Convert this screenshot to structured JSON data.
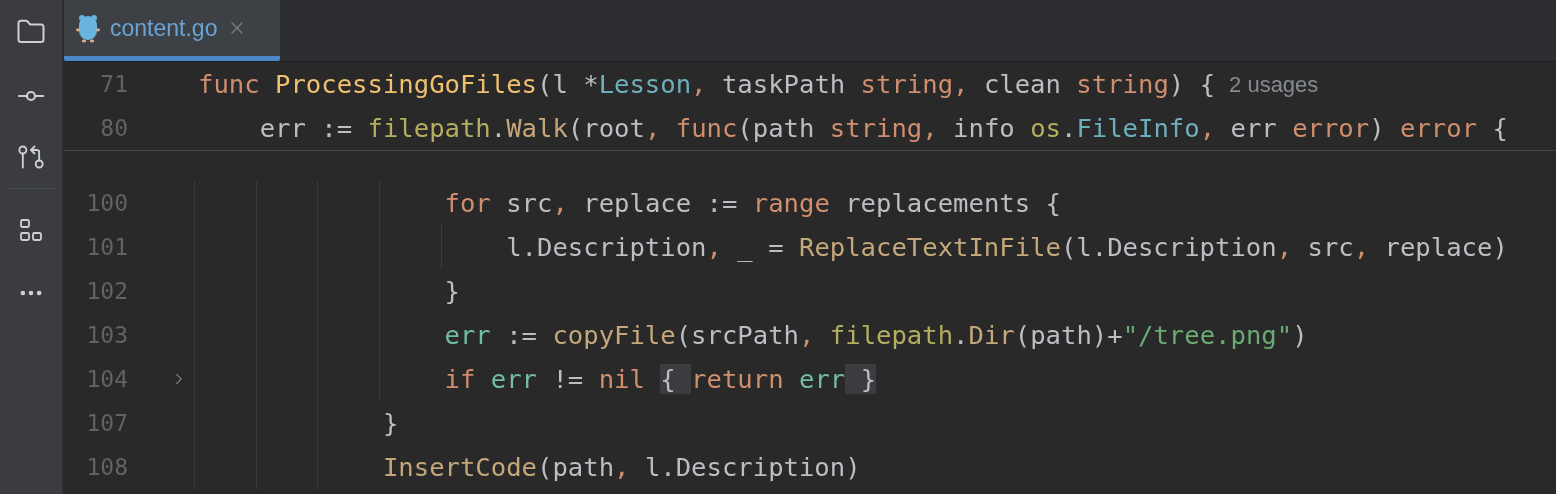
{
  "tabs": [
    {
      "label": "content.go",
      "selected": true
    }
  ],
  "sticky_lines": [
    {
      "number": "71",
      "hint": "2 usages",
      "tokens": [
        {
          "text": "func ",
          "kind": "keyword"
        },
        {
          "text": "ProcessingGoFiles",
          "kind": "decl"
        },
        {
          "text": "(l *",
          "kind": "plain"
        },
        {
          "text": "Lesson",
          "kind": "type"
        },
        {
          "text": ",",
          "kind": "keyword"
        },
        {
          "text": " taskPath ",
          "kind": "plain"
        },
        {
          "text": "string",
          "kind": "keyword"
        },
        {
          "text": ",",
          "kind": "keyword"
        },
        {
          "text": " clean ",
          "kind": "plain"
        },
        {
          "text": "string",
          "kind": "keyword"
        },
        {
          "text": ") {",
          "kind": "plain"
        }
      ]
    },
    {
      "number": "80",
      "tokens": [
        {
          "text": "    err := ",
          "kind": "plain"
        },
        {
          "text": "filepath",
          "kind": "package"
        },
        {
          "text": ".",
          "kind": "plain"
        },
        {
          "text": "Walk",
          "kind": "call"
        },
        {
          "text": "(root",
          "kind": "plain"
        },
        {
          "text": ", ",
          "kind": "keyword"
        },
        {
          "text": "func",
          "kind": "keyword"
        },
        {
          "text": "(path ",
          "kind": "plain"
        },
        {
          "text": "string",
          "kind": "keyword"
        },
        {
          "text": ",",
          "kind": "keyword"
        },
        {
          "text": " info ",
          "kind": "plain"
        },
        {
          "text": "os",
          "kind": "package"
        },
        {
          "text": ".",
          "kind": "plain"
        },
        {
          "text": "FileInfo",
          "kind": "type"
        },
        {
          "text": ",",
          "kind": "keyword"
        },
        {
          "text": " err ",
          "kind": "plain"
        },
        {
          "text": "error",
          "kind": "keyword"
        },
        {
          "text": ") ",
          "kind": "plain"
        },
        {
          "text": "error",
          "kind": "keyword"
        },
        {
          "text": " {",
          "kind": "plain"
        }
      ]
    }
  ],
  "lines": [
    {
      "number": "100",
      "folded": false,
      "tokens": [
        {
          "text": "                for",
          "kind": "keyword"
        },
        {
          "text": " src",
          "kind": "plain"
        },
        {
          "text": ",",
          "kind": "keyword"
        },
        {
          "text": " replace := ",
          "kind": "plain"
        },
        {
          "text": "range",
          "kind": "keyword"
        },
        {
          "text": " replacements {",
          "kind": "plain"
        }
      ]
    },
    {
      "number": "101",
      "folded": false,
      "tokens": [
        {
          "text": "                    l.Description",
          "kind": "plain"
        },
        {
          "text": ",",
          "kind": "keyword"
        },
        {
          "text": " _ = ",
          "kind": "plain"
        },
        {
          "text": "ReplaceTextInFile",
          "kind": "call"
        },
        {
          "text": "(l.Description",
          "kind": "plain"
        },
        {
          "text": ",",
          "kind": "keyword"
        },
        {
          "text": " src",
          "kind": "plain"
        },
        {
          "text": ",",
          "kind": "keyword"
        },
        {
          "text": " replace)",
          "kind": "plain"
        }
      ]
    },
    {
      "number": "102",
      "folded": false,
      "tokens": [
        {
          "text": "                }",
          "kind": "plain"
        }
      ]
    },
    {
      "number": "103",
      "folded": false,
      "tokens": [
        {
          "text": "                err",
          "kind": "var"
        },
        {
          "text": " := ",
          "kind": "plain"
        },
        {
          "text": "copyFile",
          "kind": "call"
        },
        {
          "text": "(srcPath",
          "kind": "plain"
        },
        {
          "text": ",",
          "kind": "keyword"
        },
        {
          "text": " filepath",
          "kind": "package"
        },
        {
          "text": ".",
          "kind": "plain"
        },
        {
          "text": "Dir",
          "kind": "call"
        },
        {
          "text": "(path)+",
          "kind": "plain"
        },
        {
          "text": "\"/tree.png\"",
          "kind": "string"
        },
        {
          "text": ")",
          "kind": "plain"
        }
      ]
    },
    {
      "number": "104",
      "folded": true,
      "tokens": [
        {
          "text": "                if",
          "kind": "keyword"
        },
        {
          "text": " err",
          "kind": "var"
        },
        {
          "text": " != ",
          "kind": "plain"
        },
        {
          "text": "nil ",
          "kind": "keyword"
        },
        {
          "text": "{",
          "kind": "fold-open"
        },
        {
          "text": "return ",
          "kind": "keyword"
        },
        {
          "text": "err",
          "kind": "var"
        },
        {
          "text": "}",
          "kind": "fold-close"
        }
      ]
    },
    {
      "number": "107",
      "folded": false,
      "tokens": [
        {
          "text": "            }",
          "kind": "plain"
        }
      ]
    },
    {
      "number": "108",
      "folded": false,
      "tokens": [
        {
          "text": "            InsertCode",
          "kind": "call"
        },
        {
          "text": "(path",
          "kind": "plain"
        },
        {
          "text": ",",
          "kind": "keyword"
        },
        {
          "text": " l.Description)",
          "kind": "plain"
        }
      ]
    }
  ]
}
